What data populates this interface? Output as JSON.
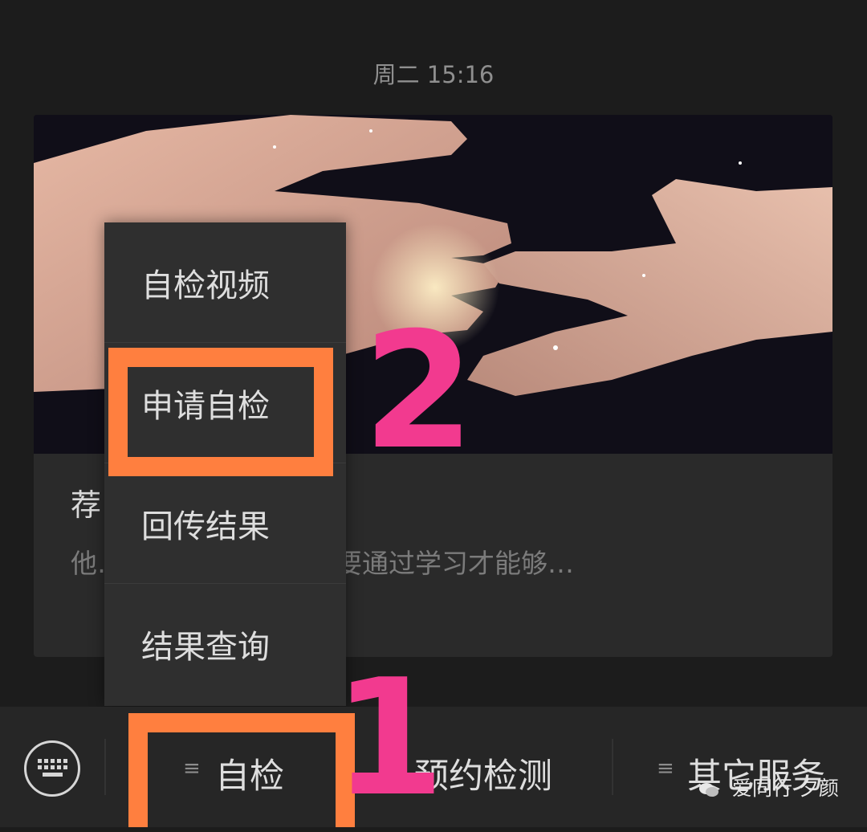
{
  "header": {
    "timestamp": "周二 15:16"
  },
  "article": {
    "title": "荐…的艺术》",
    "description": "他…生俱来的能力，需要通过学习才能够…"
  },
  "popup_menu": {
    "items": [
      {
        "label": "自检视频"
      },
      {
        "label": "申请自检"
      },
      {
        "label": "回传结果"
      },
      {
        "label": "结果查询"
      }
    ]
  },
  "annotations": {
    "step_one": "1",
    "step_two": "2",
    "box_color": "#ff7f3f",
    "digit_color": "#f23a8f"
  },
  "bottom_bar": {
    "keyboard_icon": "keyboard-icon",
    "menu_icon": "menu-lines-icon",
    "tabs": [
      {
        "label": "自检"
      },
      {
        "label": "预约检测"
      },
      {
        "label": "其它服务"
      }
    ]
  },
  "watermark": {
    "text": "爱同行 夕颜"
  }
}
